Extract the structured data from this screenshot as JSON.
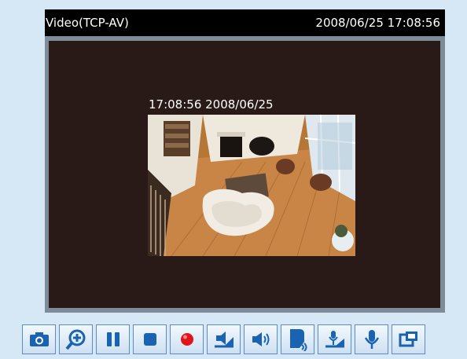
{
  "viewer": {
    "title": "Video(TCP-AV)",
    "datetime": "2008/06/25 17:08:56",
    "overlay_text": "17:08:56 2008/06/25"
  },
  "toolbar": {
    "buttons": [
      {
        "name": "snapshot",
        "icon": "camera-icon"
      },
      {
        "name": "digital-zoom",
        "icon": "zoom-in-icon"
      },
      {
        "name": "pause",
        "icon": "pause-icon"
      },
      {
        "name": "stop",
        "icon": "stop-icon"
      },
      {
        "name": "record",
        "icon": "record-icon"
      },
      {
        "name": "volume",
        "icon": "volume-icon"
      },
      {
        "name": "speaker",
        "icon": "speaker-icon"
      },
      {
        "name": "mute",
        "icon": "mute-icon"
      },
      {
        "name": "talk",
        "icon": "talk-icon"
      },
      {
        "name": "microphone",
        "icon": "microphone-icon"
      },
      {
        "name": "fullscreen",
        "icon": "fullscreen-icon"
      }
    ]
  },
  "colors": {
    "page_background": "#d6e8f6",
    "icon_blue": "#1a63b3",
    "record_red": "#e0141a"
  }
}
